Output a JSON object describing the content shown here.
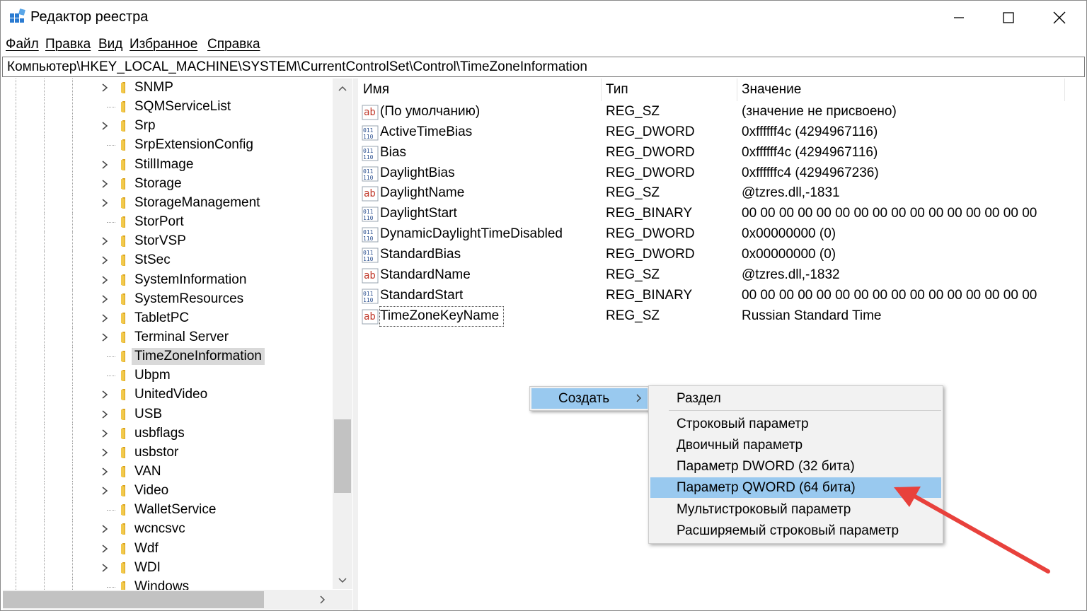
{
  "window": {
    "title": "Редактор реестра"
  },
  "menu": [
    "Файл",
    "Правка",
    "Вид",
    "Избранное",
    "Справка"
  ],
  "address": "Компьютер\\HKEY_LOCAL_MACHINE\\SYSTEM\\CurrentControlSet\\Control\\TimeZoneInformation",
  "tree": {
    "items": [
      {
        "label": "SNMP",
        "expandable": true
      },
      {
        "label": "SQMServiceList",
        "expandable": false
      },
      {
        "label": "Srp",
        "expandable": true
      },
      {
        "label": "SrpExtensionConfig",
        "expandable": false
      },
      {
        "label": "StillImage",
        "expandable": true
      },
      {
        "label": "Storage",
        "expandable": true
      },
      {
        "label": "StorageManagement",
        "expandable": true
      },
      {
        "label": "StorPort",
        "expandable": false
      },
      {
        "label": "StorVSP",
        "expandable": true
      },
      {
        "label": "StSec",
        "expandable": true
      },
      {
        "label": "SystemInformation",
        "expandable": true
      },
      {
        "label": "SystemResources",
        "expandable": true
      },
      {
        "label": "TabletPC",
        "expandable": true
      },
      {
        "label": "Terminal Server",
        "expandable": true
      },
      {
        "label": "TimeZoneInformation",
        "expandable": false,
        "selected": true
      },
      {
        "label": "Ubpm",
        "expandable": false
      },
      {
        "label": "UnitedVideo",
        "expandable": true
      },
      {
        "label": "USB",
        "expandable": true
      },
      {
        "label": "usbflags",
        "expandable": true
      },
      {
        "label": "usbstor",
        "expandable": true
      },
      {
        "label": "VAN",
        "expandable": true
      },
      {
        "label": "Video",
        "expandable": true
      },
      {
        "label": "WalletService",
        "expandable": false
      },
      {
        "label": "wcncsvc",
        "expandable": true
      },
      {
        "label": "Wdf",
        "expandable": true
      },
      {
        "label": "WDI",
        "expandable": true
      },
      {
        "label": "Windows",
        "expandable": false
      }
    ]
  },
  "list": {
    "columns": {
      "name": "Имя",
      "type": "Тип",
      "data": "Значение"
    },
    "rows": [
      {
        "icon": "string-value-icon",
        "name": "(По умолчанию)",
        "type": "REG_SZ",
        "data": "(значение не присвоено)"
      },
      {
        "icon": "binary-value-icon",
        "name": "ActiveTimeBias",
        "type": "REG_DWORD",
        "data": "0xffffff4c (4294967116)"
      },
      {
        "icon": "binary-value-icon",
        "name": "Bias",
        "type": "REG_DWORD",
        "data": "0xffffff4c (4294967116)"
      },
      {
        "icon": "binary-value-icon",
        "name": "DaylightBias",
        "type": "REG_DWORD",
        "data": "0xffffffc4 (4294967236)"
      },
      {
        "icon": "string-value-icon",
        "name": "DaylightName",
        "type": "REG_SZ",
        "data": "@tzres.dll,-1831"
      },
      {
        "icon": "binary-value-icon",
        "name": "DaylightStart",
        "type": "REG_BINARY",
        "data": "00 00 00 00 00 00 00 00 00 00 00 00 00 00 00 00"
      },
      {
        "icon": "binary-value-icon",
        "name": "DynamicDaylightTimeDisabled",
        "type": "REG_DWORD",
        "data": "0x00000000 (0)"
      },
      {
        "icon": "binary-value-icon",
        "name": "StandardBias",
        "type": "REG_DWORD",
        "data": "0x00000000 (0)"
      },
      {
        "icon": "string-value-icon",
        "name": "StandardName",
        "type": "REG_SZ",
        "data": "@tzres.dll,-1832"
      },
      {
        "icon": "binary-value-icon",
        "name": "StandardStart",
        "type": "REG_BINARY",
        "data": "00 00 00 00 00 00 00 00 00 00 00 00 00 00 00 00"
      },
      {
        "icon": "string-value-icon",
        "name": "TimeZoneKeyName",
        "type": "REG_SZ",
        "data": "Russian Standard Time",
        "focused": true
      }
    ]
  },
  "context_menu": {
    "create_label": "Создать",
    "submenu": [
      {
        "label": "Раздел"
      },
      {
        "label": "Строковый параметр"
      },
      {
        "label": "Двоичный параметр"
      },
      {
        "label": "Параметр DWORD (32 бита)"
      },
      {
        "label": "Параметр QWORD (64 бита)",
        "highlighted": true
      },
      {
        "label": "Мультистроковый параметр"
      },
      {
        "label": "Расширяемый строковый параметр"
      }
    ]
  },
  "colors": {
    "highlight": "#99c9ef",
    "selection": "#d9d9d9",
    "annotation_arrow": "#e8413c",
    "folder": "#f2c94c"
  }
}
